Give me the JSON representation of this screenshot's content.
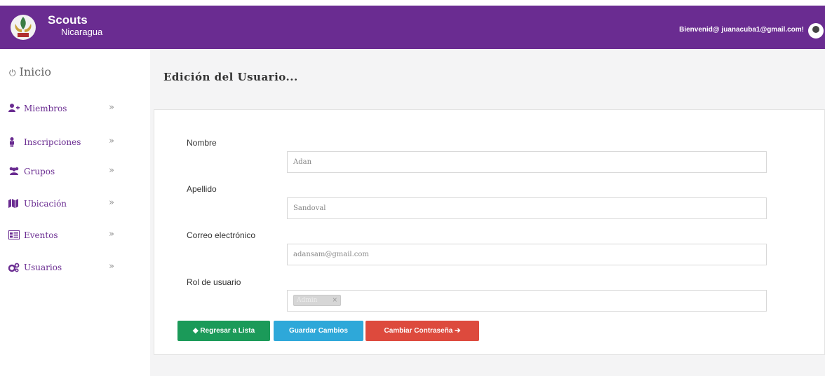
{
  "header": {
    "brand_line1": "Scouts",
    "brand_line2": "Nicaragua",
    "welcome": "Bienvenid@ juanacuba1@gmail.com!"
  },
  "sidebar": {
    "inicio": "Inicio",
    "items": [
      {
        "label": "Miembros",
        "icon": "user-plus-icon"
      },
      {
        "label": "Inscripciones",
        "icon": "person-icon"
      },
      {
        "label": "Grupos",
        "icon": "users-icon"
      },
      {
        "label": "Ubicación",
        "icon": "map-icon"
      },
      {
        "label": "Eventos",
        "icon": "calendar-icon"
      },
      {
        "label": "Usuarios",
        "icon": "gears-icon"
      }
    ]
  },
  "main": {
    "title": "Edición del Usuario...",
    "form": {
      "nombre_label": "Nombre",
      "nombre_value": "Adan",
      "apellido_label": "Apellido",
      "apellido_value": "Sandoval",
      "correo_label": "Correo electrónico",
      "correo_value": "adansam@gmail.com",
      "rol_label": "Rol de usuario",
      "rol_tag": "Admin",
      "rol_tag_remove": "×"
    },
    "buttons": {
      "back": "Regresar a Lista",
      "save": "Guardar Cambios",
      "password": "Cambiar Contraseña"
    }
  },
  "colors": {
    "brand": "#6a2c91",
    "back_button": "#1b9a59",
    "save_button": "#2ea8d9",
    "password_button": "#dd4a3d"
  }
}
